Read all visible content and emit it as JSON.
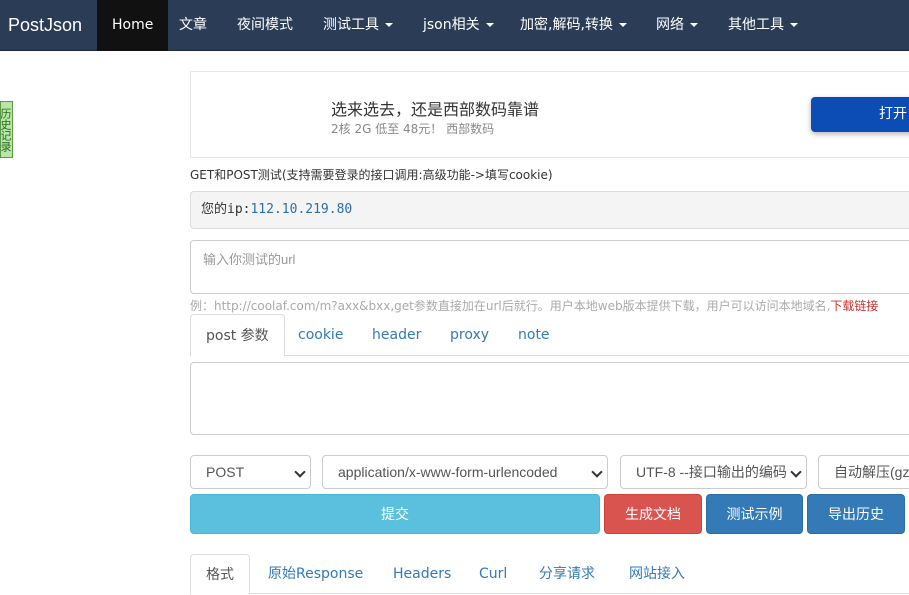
{
  "navbar": {
    "brand": "PostJson",
    "items": [
      {
        "label": "Home",
        "active": true
      },
      {
        "label": "文章"
      },
      {
        "label": "夜间模式"
      },
      {
        "label": "测试工具",
        "dropdown": true
      },
      {
        "label": "json相关",
        "dropdown": true
      },
      {
        "label": "加密,解码,转换",
        "dropdown": true
      },
      {
        "label": "网络",
        "dropdown": true
      },
      {
        "label": "其他工具",
        "dropdown": true
      }
    ]
  },
  "history_tab": "历史记录",
  "ad": {
    "title": "选来选去，还是西部数码靠谱",
    "subtitle": "2核 2G 低至 48元！ 西部数码",
    "button": "打开"
  },
  "intro": "GET和POST测试(支持需要登录的接口调用:高级功能->填写cookie)",
  "ip": {
    "label": "您的ip:",
    "value": "112.10.219.80"
  },
  "url_input": {
    "placeholder": "输入你测试的url",
    "value": ""
  },
  "hint": {
    "text": "例：http://coolaf.com/m?axx&bxx,get参数直接加在url后就行。用户本地web版本提供下载，用户可以访问本地域名,",
    "link": "下载链接"
  },
  "param_tabs": [
    "post 参数",
    "cookie",
    "header",
    "proxy",
    "note"
  ],
  "selects": {
    "method": "POST",
    "content_type": "application/x-www-form-urlencoded",
    "charset": "UTF-8 --接口输出的编码",
    "decompress": "自动解压(gz"
  },
  "buttons": {
    "submit": "提交",
    "generate_doc": "生成文档",
    "test_sample": "测试示例",
    "export_history": "导出历史"
  },
  "result_tabs": [
    "格式",
    "原始Response",
    "Headers",
    "Curl",
    "分享请求",
    "网站接入"
  ]
}
